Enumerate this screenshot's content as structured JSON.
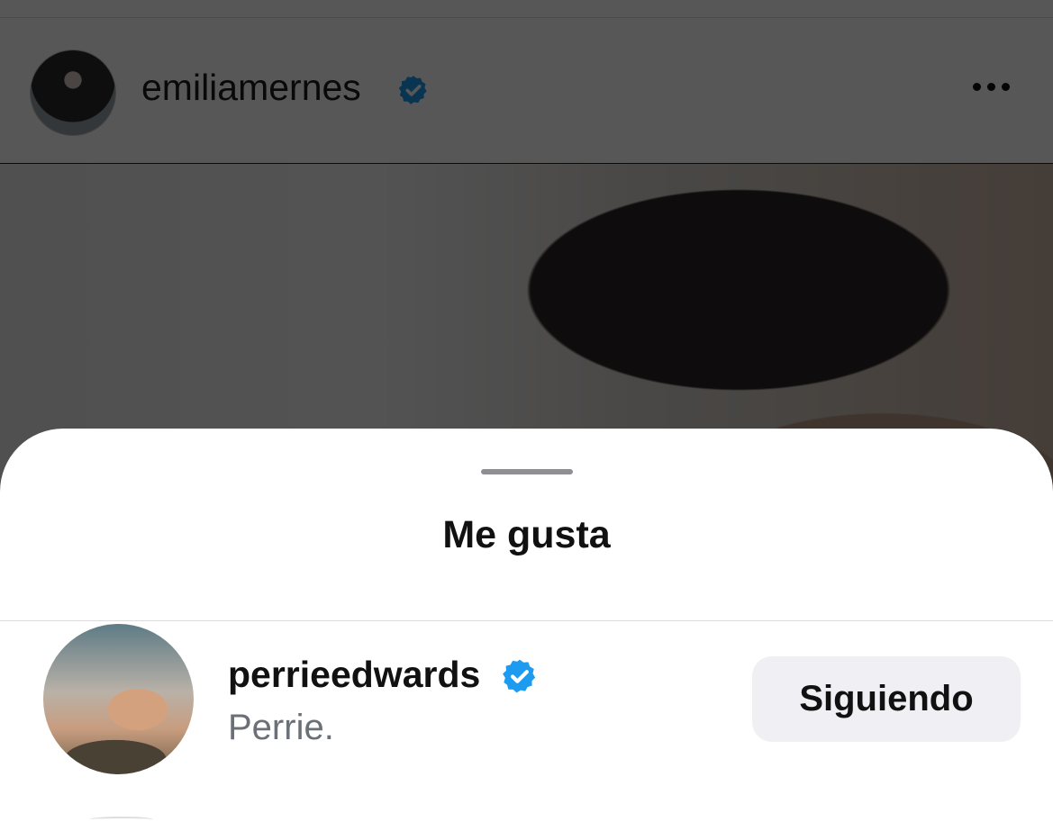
{
  "post": {
    "username": "emiliamernes",
    "verified": true
  },
  "sheet": {
    "title": "Me gusta"
  },
  "likes": [
    {
      "username": "perrieedwards",
      "verified": true,
      "full_name": "Perrie.",
      "button_label": "Siguiendo"
    }
  ],
  "colors": {
    "verified_blue": "#1d9bf0",
    "button_bg": "#efeff4",
    "overlay": "rgba(0,0,0,0.66)"
  },
  "icons": {
    "more": "more-horizontal-icon",
    "verified": "verified-badge-icon"
  }
}
